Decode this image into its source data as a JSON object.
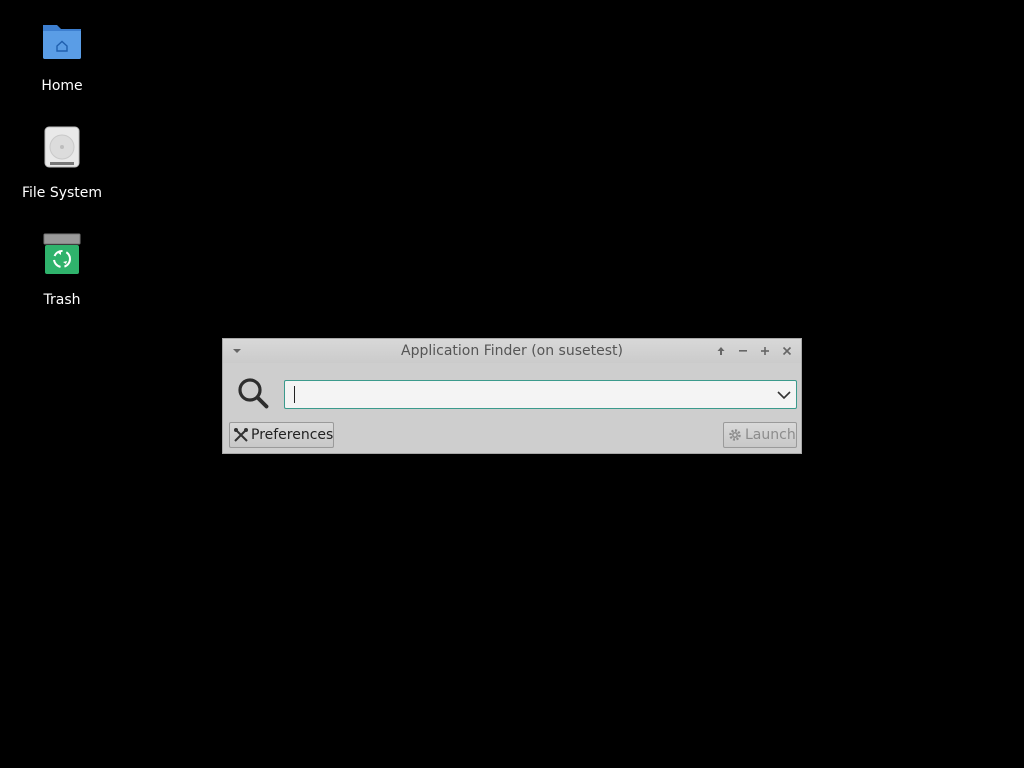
{
  "desktop": {
    "icons": [
      {
        "label": "Home",
        "icon": "home-folder-icon"
      },
      {
        "label": "File System",
        "icon": "hard-drive-icon"
      },
      {
        "label": "Trash",
        "icon": "trash-icon"
      }
    ]
  },
  "window": {
    "title": "Application Finder (on susetest)",
    "controls": [
      "window-menu-icon",
      "keep-above-icon",
      "minimize-icon",
      "maximize-icon",
      "close-icon"
    ],
    "search": {
      "value": "",
      "placeholder": "",
      "icon": "search-icon",
      "dropdown_icon": "chevron-down-icon"
    },
    "preferences_label": "Preferences",
    "preferences_icon": "tools-icon",
    "launch_label": "Launch",
    "launch_icon": "gear-icon",
    "launch_enabled": false
  },
  "colors": {
    "desktop_bg": "#000000",
    "window_bg": "#cecece",
    "accent": "#3b9a8c",
    "folder_blue": "#4a90d9",
    "trash_green": "#2fb36c"
  }
}
